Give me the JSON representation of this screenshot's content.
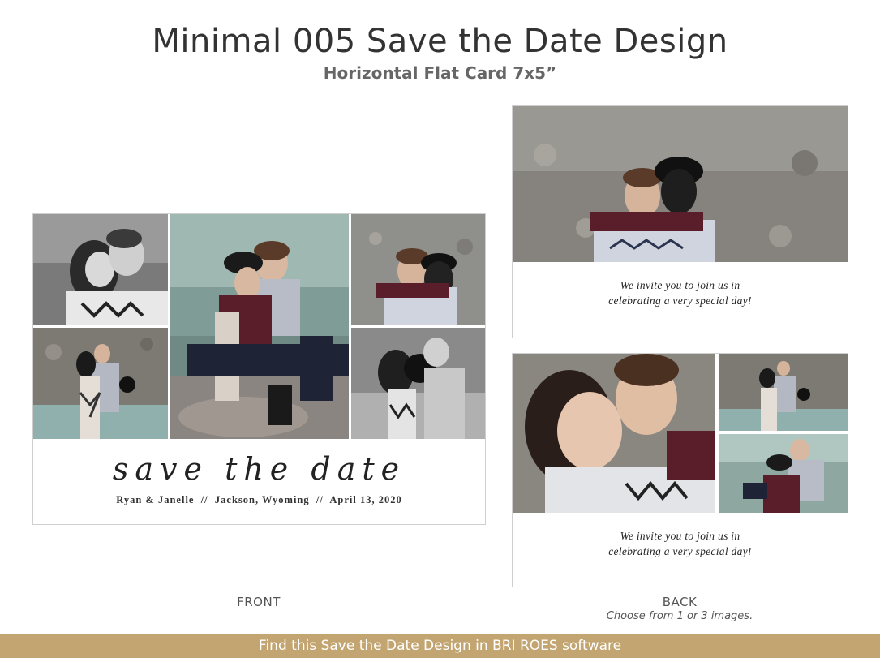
{
  "header": {
    "title": "Minimal 005 Save the Date Design",
    "subtitle": "Horizontal Flat Card 7x5”"
  },
  "front": {
    "script_text": "save the date",
    "details": "Ryan & Janelle  //  Jackson, Wyoming  //  April 13, 2020",
    "caption": "FRONT"
  },
  "back": {
    "invite_line1": "We invite you to join us in",
    "invite_line2": "celebrating a very special day!",
    "caption": "BACK",
    "note": "Choose from 1 or 3 images."
  },
  "footer": {
    "text": "Find this Save the Date Design in BRI ROES software"
  },
  "colors": {
    "footer_bar": "#c2a571",
    "title": "#333333",
    "subtitle": "#666666"
  }
}
